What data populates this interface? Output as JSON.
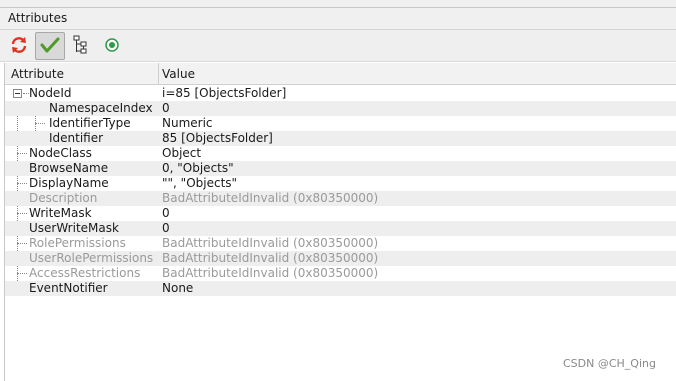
{
  "panel": {
    "title": "Attributes"
  },
  "toolbar": {
    "buttons": [
      {
        "icon": "refresh-icon"
      },
      {
        "icon": "checkmark-icon",
        "pressed": true
      },
      {
        "icon": "tree-hierarchy-icon"
      },
      {
        "icon": "target-icon"
      }
    ]
  },
  "table": {
    "headers": {
      "attribute": "Attribute",
      "value": "Value"
    },
    "rows": [
      {
        "name": "NodeId",
        "value": "i=85 [ObjectsFolder]",
        "level": 0,
        "expandable": true,
        "dim": false
      },
      {
        "name": "NamespaceIndex",
        "value": "0",
        "level": 1,
        "dim": false
      },
      {
        "name": "IdentifierType",
        "value": "Numeric",
        "level": 1,
        "dim": false
      },
      {
        "name": "Identifier",
        "value": "85 [ObjectsFolder]",
        "level": 1,
        "dim": false
      },
      {
        "name": "NodeClass",
        "value": "Object",
        "level": 0,
        "dim": false
      },
      {
        "name": "BrowseName",
        "value": "0, \"Objects\"",
        "level": 0,
        "dim": false
      },
      {
        "name": "DisplayName",
        "value": "\"\", \"Objects\"",
        "level": 0,
        "dim": false
      },
      {
        "name": "Description",
        "value": "BadAttributeIdInvalid (0x80350000)",
        "level": 0,
        "dim": true
      },
      {
        "name": "WriteMask",
        "value": "0",
        "level": 0,
        "dim": false
      },
      {
        "name": "UserWriteMask",
        "value": "0",
        "level": 0,
        "dim": false
      },
      {
        "name": "RolePermissions",
        "value": "BadAttributeIdInvalid (0x80350000)",
        "level": 0,
        "dim": true
      },
      {
        "name": "UserRolePermissions",
        "value": "BadAttributeIdInvalid (0x80350000)",
        "level": 0,
        "dim": true
      },
      {
        "name": "AccessRestrictions",
        "value": "BadAttributeIdInvalid (0x80350000)",
        "level": 0,
        "dim": true
      },
      {
        "name": "EventNotifier",
        "value": "None",
        "level": 0,
        "dim": false
      }
    ]
  },
  "watermark": "CSDN @CH_Qing"
}
